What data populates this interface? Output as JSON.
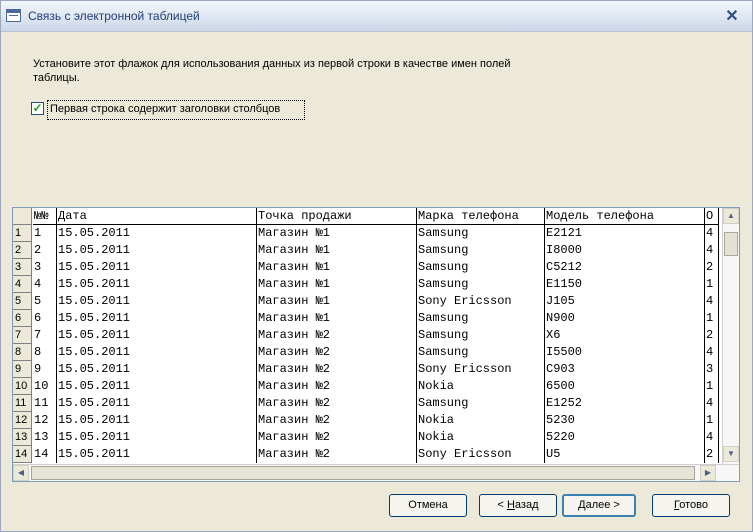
{
  "window": {
    "title": "Связь с электронной таблицей",
    "close_symbol": "✕"
  },
  "description": "Установите этот флажок для использования данных из первой строки в качестве имен полей таблицы.",
  "checkbox": {
    "checked": true,
    "label": "Первая строка содержит заголовки столбцов"
  },
  "table": {
    "columns": [
      "№№",
      "Дата",
      "Точка продажи",
      "Марка телефона",
      "Модель телефона",
      "О"
    ],
    "rows": [
      [
        "1",
        "1",
        "15.05.2011",
        "Магазин №1",
        "Samsung",
        "E2121",
        "4"
      ],
      [
        "2",
        "2",
        "15.05.2011",
        "Магазин №1",
        "Samsung",
        "I8000",
        "4"
      ],
      [
        "3",
        "3",
        "15.05.2011",
        "Магазин №1",
        "Samsung",
        "C5212",
        "2"
      ],
      [
        "4",
        "4",
        "15.05.2011",
        "Магазин №1",
        "Samsung",
        "E1150",
        "1"
      ],
      [
        "5",
        "5",
        "15.05.2011",
        "Магазин №1",
        "Sony Ericsson",
        "J105",
        "4"
      ],
      [
        "6",
        "6",
        "15.05.2011",
        "Магазин №1",
        "Samsung",
        "N900",
        "1"
      ],
      [
        "7",
        "7",
        "15.05.2011",
        "Магазин №2",
        "Samsung",
        "X6",
        "2"
      ],
      [
        "8",
        "8",
        "15.05.2011",
        "Магазин №2",
        "Samsung",
        "I5500",
        "4"
      ],
      [
        "9",
        "9",
        "15.05.2011",
        "Магазин №2",
        "Sony Ericsson",
        "C903",
        "3"
      ],
      [
        "10",
        "10",
        "15.05.2011",
        "Магазин №2",
        "Nokia",
        "6500",
        "1"
      ],
      [
        "11",
        "11",
        "15.05.2011",
        "Магазин №2",
        "Samsung",
        "E1252",
        "4"
      ],
      [
        "12",
        "12",
        "15.05.2011",
        "Магазин №2",
        "Nokia",
        "5230",
        "1"
      ],
      [
        "13",
        "13",
        "15.05.2011",
        "Магазин №2",
        "Nokia",
        "5220",
        "4"
      ],
      [
        "14",
        "14",
        "15.05.2011",
        "Магазин №2",
        "Sony Ericsson",
        "U5",
        "2"
      ]
    ]
  },
  "buttons": {
    "cancel": "Отмена",
    "back_prefix": "< ",
    "back_hotkey": "Н",
    "back_rest": "азад",
    "next_hotkey": "Д",
    "next_rest": "алее >",
    "finish_hotkey": "Г",
    "finish_rest": "отово"
  },
  "colors": {
    "accent": "#1e3f78",
    "check": "#21a121",
    "background": "#ece9d8"
  }
}
